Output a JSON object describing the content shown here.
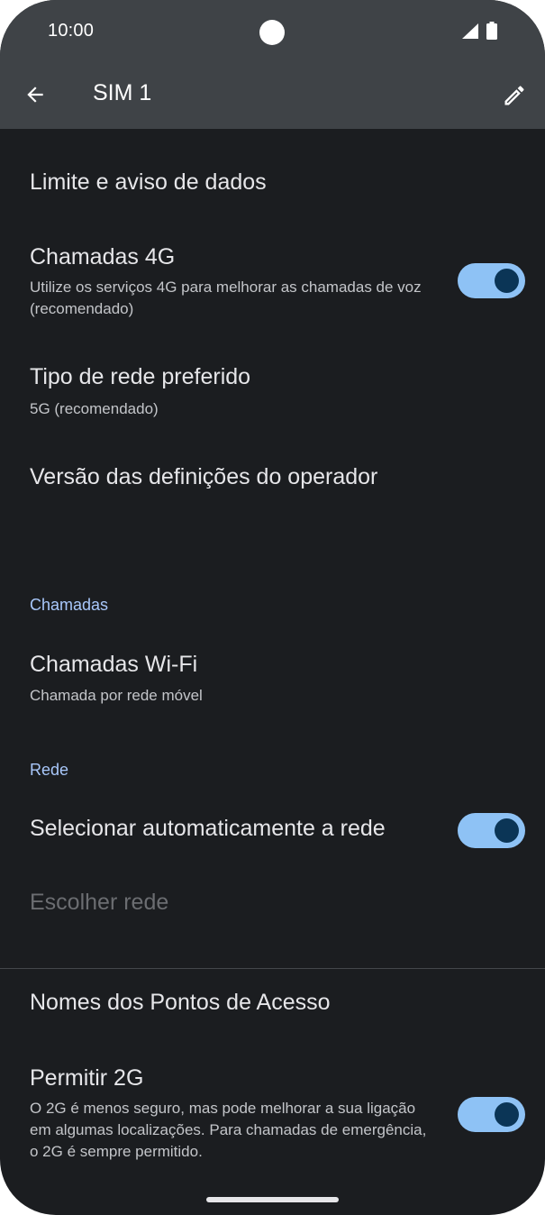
{
  "status_bar": {
    "time": "10:00"
  },
  "app_bar": {
    "title": "SIM 1",
    "back_icon": "arrow-back-icon",
    "edit_icon": "pencil-icon"
  },
  "settings": {
    "data_limit": {
      "title": "Limite e aviso de dados"
    },
    "volte": {
      "title": "Chamadas 4G",
      "subtitle": "Utilize os serviços 4G para melhorar as chamadas de voz (recomendado)",
      "enabled": true
    },
    "network_type": {
      "title": "Tipo de rede preferido",
      "subtitle": "5G (recomendado)"
    },
    "carrier_version": {
      "title": "Versão das definições do operador"
    },
    "calls_header": "Chamadas",
    "wifi_calling": {
      "title": "Chamadas Wi-Fi",
      "subtitle": "Chamada por rede móvel"
    },
    "network_header": "Rede",
    "auto_network": {
      "title": "Selecionar automaticamente a rede",
      "enabled": true
    },
    "choose_network": {
      "title": "Escolher rede"
    },
    "apn": {
      "title": "Nomes dos Pontos de Acesso"
    },
    "allow_2g": {
      "title": "Permitir 2G",
      "subtitle": "O 2G é menos seguro, mas pode melhorar a sua ligação em algumas localizações. Para chamadas de emergência, o 2G é sempre permitido.",
      "enabled": true
    }
  },
  "colors": {
    "background": "#1b1d20",
    "app_bar": "#3f4347",
    "accent": "#a8c7fa",
    "toggle_track": "#8ec2f5",
    "toggle_thumb": "#0b3556"
  }
}
